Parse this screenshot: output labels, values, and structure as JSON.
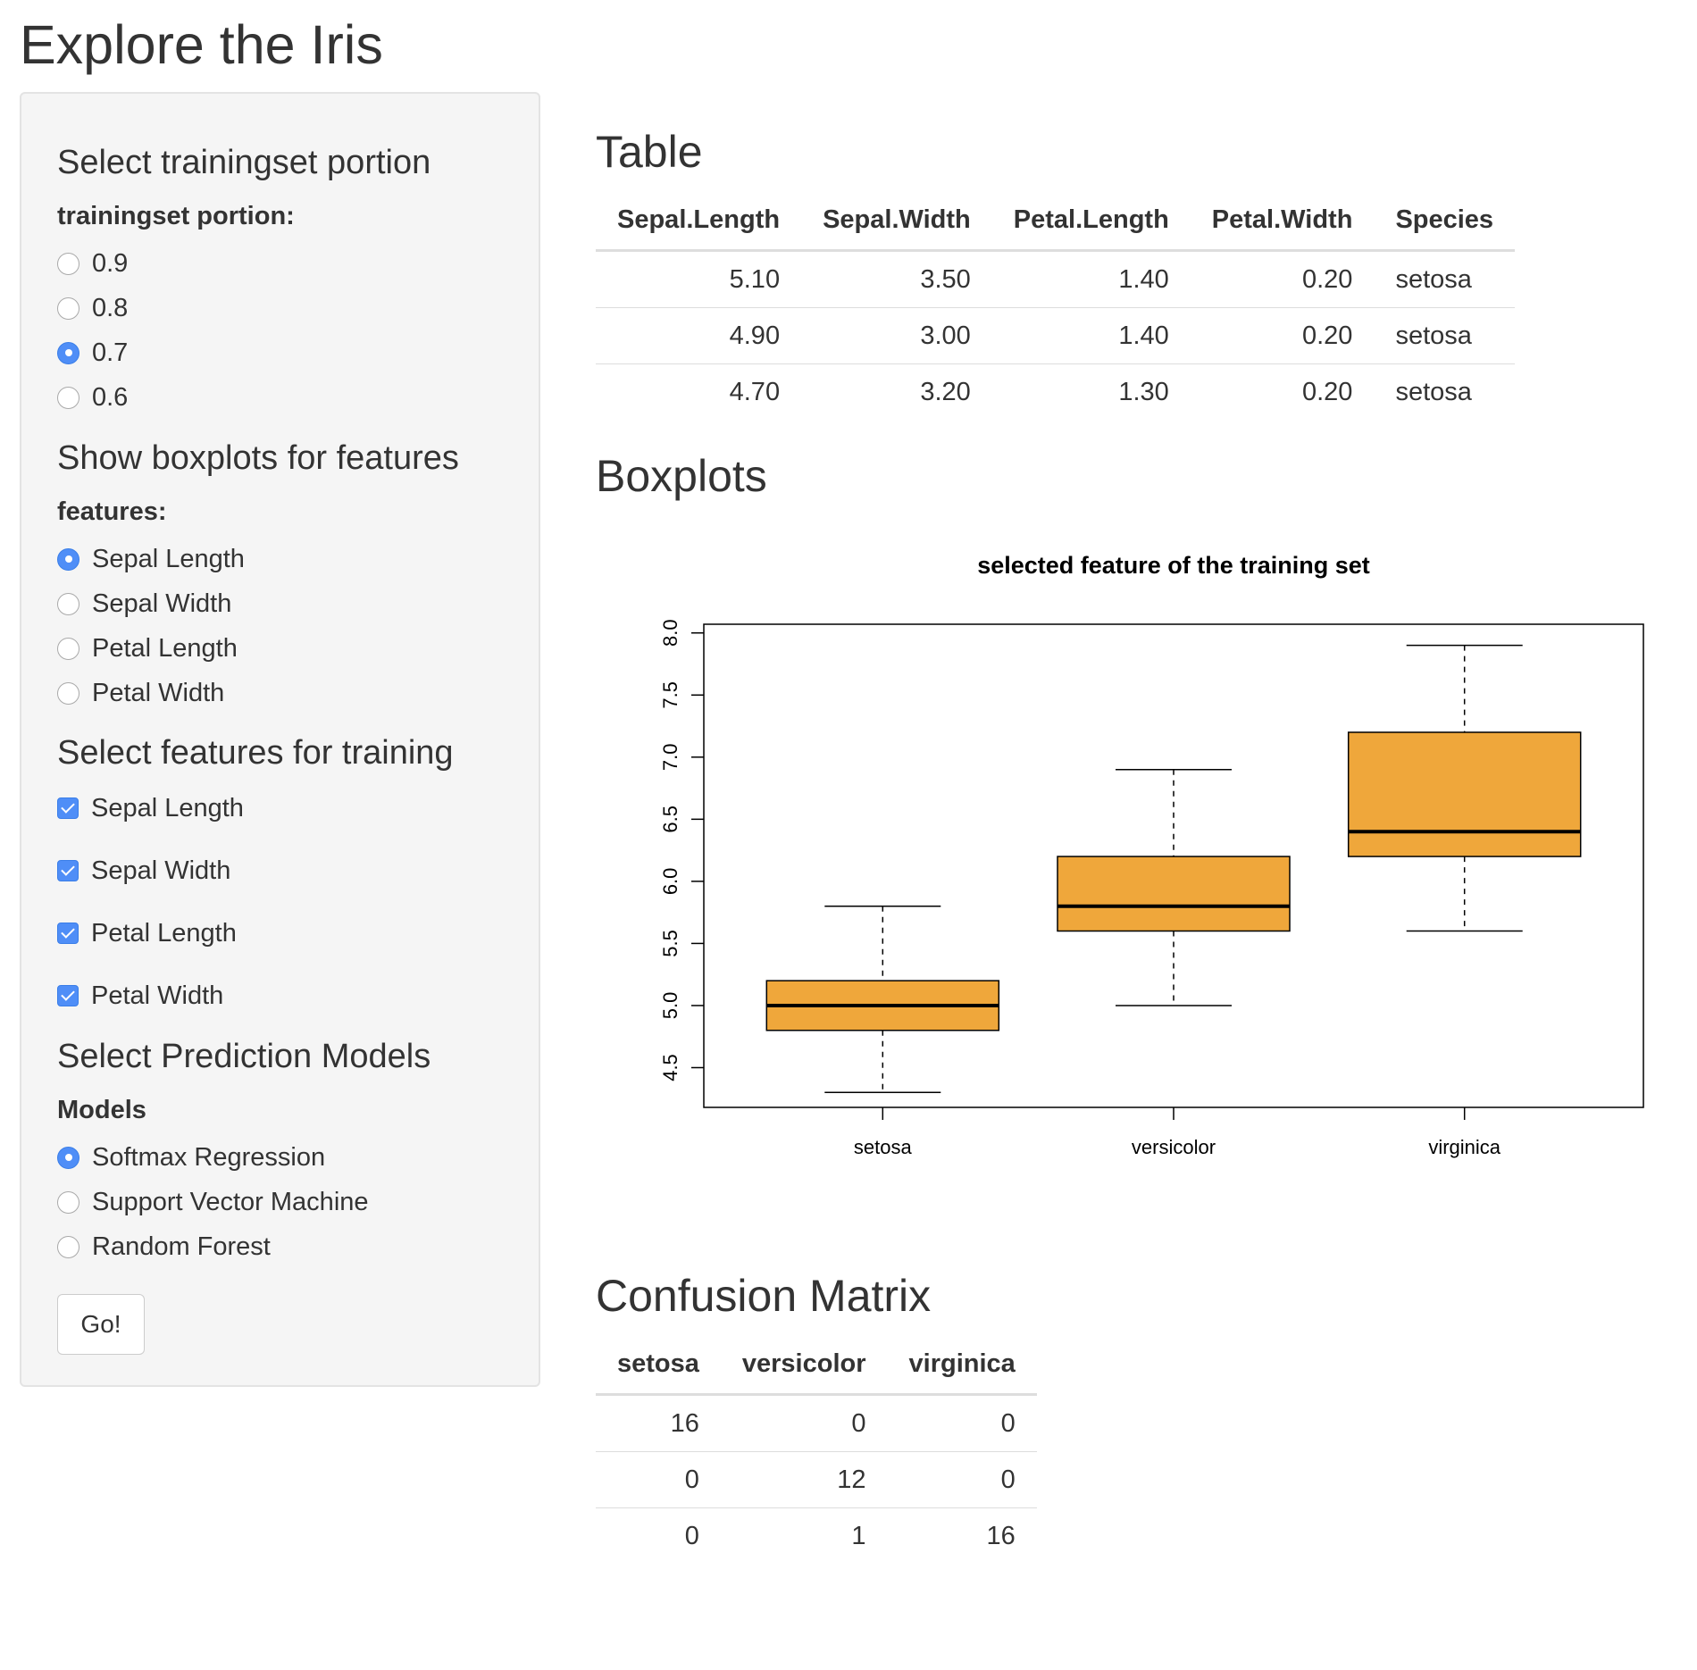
{
  "page": {
    "title": "Explore the Iris"
  },
  "sidebar": {
    "portion": {
      "heading": "Select trainingset portion",
      "label": "trainingset portion:",
      "options": [
        "0.9",
        "0.8",
        "0.7",
        "0.6"
      ],
      "selected": "0.7"
    },
    "boxplot_feature": {
      "heading": "Show boxplots for features",
      "label": "features:",
      "options": [
        "Sepal Length",
        "Sepal Width",
        "Petal Length",
        "Petal Width"
      ],
      "selected": "Sepal Length"
    },
    "training_features": {
      "heading": "Select features for training",
      "options": [
        "Sepal Length",
        "Sepal Width",
        "Petal Length",
        "Petal Width"
      ],
      "checked": [
        true,
        true,
        true,
        true
      ]
    },
    "models": {
      "heading": "Select Prediction Models",
      "label": "Models",
      "options": [
        "Softmax Regression",
        "Support Vector Machine",
        "Random Forest"
      ],
      "selected": "Softmax Regression"
    },
    "go_label": "Go!"
  },
  "main": {
    "table": {
      "heading": "Table",
      "columns": [
        "Sepal.Length",
        "Sepal.Width",
        "Petal.Length",
        "Petal.Width",
        "Species"
      ],
      "rows": [
        [
          "5.10",
          "3.50",
          "1.40",
          "0.20",
          "setosa"
        ],
        [
          "4.90",
          "3.00",
          "1.40",
          "0.20",
          "setosa"
        ],
        [
          "4.70",
          "3.20",
          "1.30",
          "0.20",
          "setosa"
        ]
      ]
    },
    "boxplots": {
      "heading": "Boxplots"
    },
    "confusion": {
      "heading": "Confusion Matrix",
      "columns": [
        "setosa",
        "versicolor",
        "virginica"
      ],
      "rows": [
        [
          "16",
          "0",
          "0"
        ],
        [
          "0",
          "12",
          "0"
        ],
        [
          "0",
          "1",
          "16"
        ]
      ]
    }
  },
  "colors": {
    "box_fill": "#efa73b",
    "radio_selected": "#4f8ef7"
  },
  "chart_data": {
    "type": "boxplot",
    "title": "selected feature of the training set",
    "categories": [
      "setosa",
      "versicolor",
      "virginica"
    ],
    "boxes": [
      {
        "min": 4.3,
        "q1": 4.8,
        "median": 5.0,
        "q3": 5.2,
        "max": 5.8
      },
      {
        "min": 5.0,
        "q1": 5.6,
        "median": 5.8,
        "q3": 6.2,
        "max": 6.9
      },
      {
        "min": 5.6,
        "q1": 6.2,
        "median": 6.4,
        "q3": 7.2,
        "max": 7.9
      }
    ],
    "yticks": [
      "4.5",
      "5.0",
      "5.5",
      "6.0",
      "6.5",
      "7.0",
      "7.5",
      "8.0"
    ],
    "ylim": [
      4.18,
      8.07
    ],
    "grid": false,
    "legend": "none",
    "xlabel": "",
    "ylabel": ""
  }
}
